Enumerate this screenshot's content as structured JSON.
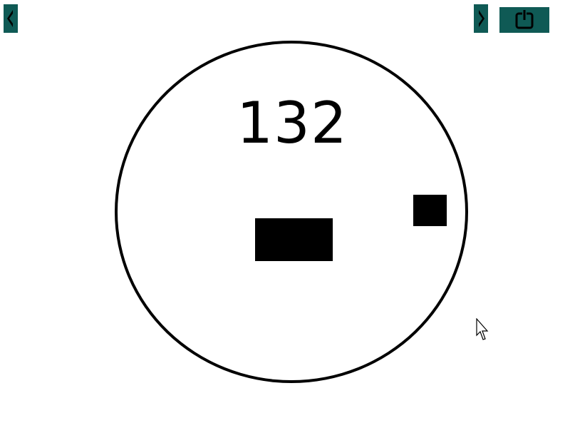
{
  "game": {
    "score": "132"
  },
  "toolbar": {
    "prev_icon": "arrow-left-icon",
    "next_icon": "arrow-right-icon",
    "power_icon": "power-icon",
    "accent_color": "#0f5a55"
  },
  "playfield": {
    "ring_color": "#000000",
    "background_color": "#ffffff"
  }
}
